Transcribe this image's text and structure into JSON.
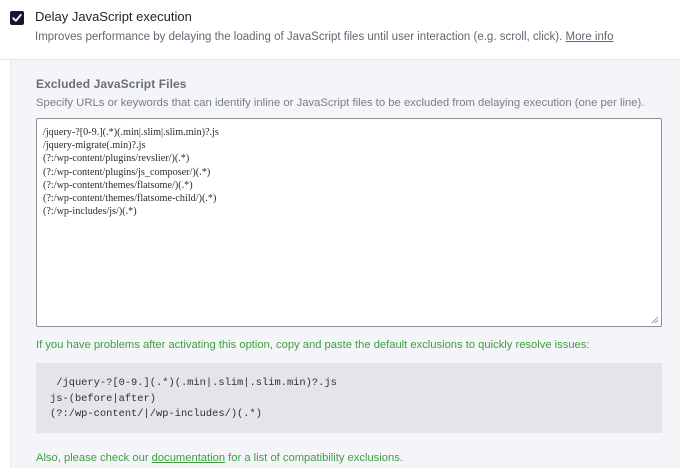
{
  "option": {
    "checked": true,
    "title": "Delay JavaScript execution",
    "description": "Improves performance by delaying the loading of JavaScript files until user interaction (e.g. scroll, click).",
    "more_info": "More info"
  },
  "excluded": {
    "title": "Excluded JavaScript Files",
    "description": "Specify URLs or keywords that can identify inline or JavaScript files to be excluded from delaying execution (one per line).",
    "value": "/jquery-?[0-9.](.*)(.min|.slim|.slim.min)?.js\n/jquery-migrate(.min)?.js\n(?:/wp-content/plugins/revslier/)(.*)\n(?:/wp-content/plugins/js_composer/)(.*)\n(?:/wp-content/themes/flatsome/)(.*)\n(?:/wp-content/themes/flatsome-child/)(.*)\n(?:/wp-includes/js/)(.*)"
  },
  "helper_text": "If you have problems after activating this option, copy and paste the default exclusions to quickly resolve issues:",
  "default_exclusions": " /jquery-?[0-9.](.*)(.min|.slim|.slim.min)?.js\njs-(before|after)\n(?:/wp-content/|/wp-includes/)(.*)",
  "footer": {
    "prefix": "Also, please check our ",
    "link": "documentation",
    "suffix": " for a list of compatibility exclusions."
  },
  "colors": {
    "checkbox": "#1d1433",
    "helper_green": "#3f9f3f",
    "section_bg": "#f4f5f8",
    "code_bg": "#e4e5e9"
  }
}
